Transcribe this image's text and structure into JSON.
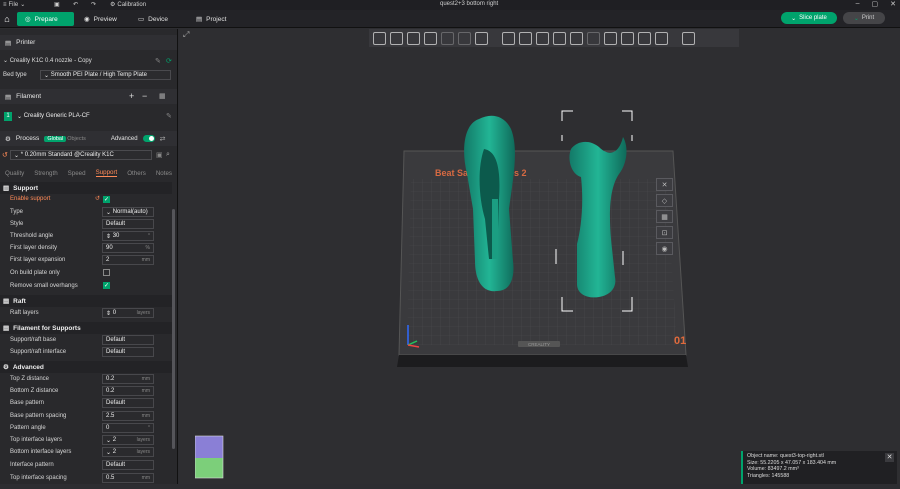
{
  "titlebar": {
    "file_label": "File",
    "calibration_label": "Calibration",
    "window_title": "quest2+3 bottom right",
    "minimize": "–",
    "maximize": "▢",
    "close": "✕"
  },
  "tabs": [
    {
      "label": "Prepare",
      "icon": "prepare-icon"
    },
    {
      "label": "Preview",
      "icon": "preview-icon"
    },
    {
      "label": "Device",
      "icon": "device-icon"
    },
    {
      "label": "Project",
      "icon": "project-icon"
    }
  ],
  "actions": {
    "slice_label": "Slice plate",
    "print_label": "Print"
  },
  "printer": {
    "section_label": "Printer",
    "name": "Creality K1C 0.4 nozzle - Copy",
    "bed_type_label": "Bed type",
    "bed_type_value": "Smooth PEI Plate / High Temp Plate"
  },
  "filament": {
    "section_label": "Filament",
    "add": "+",
    "remove": "−",
    "slot": "1",
    "name": "Creality Generic PLA-CF"
  },
  "process": {
    "section_label": "Process",
    "global_label": "Global",
    "objects_label": "Objects",
    "advanced_label": "Advanced",
    "preset": "* 0.20mm Standard @Creality K1C"
  },
  "process_tabs": [
    "Quality",
    "Strength",
    "Speed",
    "Support",
    "Others",
    "Notes"
  ],
  "support": {
    "group_label": "Support",
    "enable_support": "Enable support",
    "type_label": "Type",
    "type_value": "Normal(auto)",
    "style_label": "Style",
    "style_value": "Default",
    "threshold_label": "Threshold angle",
    "threshold_value": "30",
    "threshold_unit": "°",
    "first_layer_density_label": "First layer density",
    "first_layer_density_value": "90",
    "first_layer_density_unit": "%",
    "first_layer_expansion_label": "First layer expansion",
    "first_layer_expansion_value": "2",
    "first_layer_expansion_unit": "mm",
    "on_build_plate_label": "On build plate only",
    "remove_small_label": "Remove small overhangs"
  },
  "raft": {
    "group_label": "Raft",
    "layers_label": "Raft layers",
    "layers_value": "0",
    "layers_unit": "layers"
  },
  "filament_supports": {
    "group_label": "Filament for Supports",
    "base_label": "Support/raft base",
    "base_value": "Default",
    "interface_label": "Support/raft interface",
    "interface_value": "Default"
  },
  "advanced": {
    "group_label": "Advanced",
    "top_z_label": "Top Z distance",
    "top_z_value": "0.2",
    "top_z_unit": "mm",
    "bottom_z_label": "Bottom Z distance",
    "bottom_z_value": "0.2",
    "bottom_z_unit": "mm",
    "base_pattern_label": "Base pattern",
    "base_pattern_value": "Default",
    "base_spacing_label": "Base pattern spacing",
    "base_spacing_value": "2.5",
    "base_spacing_unit": "mm",
    "pattern_angle_label": "Pattern angle",
    "pattern_angle_value": "0",
    "pattern_angle_unit": "°",
    "top_interface_label": "Top interface layers",
    "top_interface_value": "2",
    "top_interface_unit": "layers",
    "bottom_interface_label": "Bottom interface layers",
    "bottom_interface_value": "2",
    "bottom_interface_unit": "layers",
    "interface_pattern_label": "Interface pattern",
    "interface_pattern_value": "Default",
    "top_interface_spacing_label": "Top interface spacing",
    "top_interface_spacing_value": "0.5",
    "top_interface_spacing_unit": "mm"
  },
  "viewport": {
    "plate_number": "01",
    "plate_text": "Beat Saber Paddles 2",
    "brand_text": "CREALITY"
  },
  "object_info": {
    "name_line": "Object name: quest3-top-right.stl",
    "size_line": "Size: 55.2205 x 47.057 x 183.404 mm",
    "volume_line": "Volume: 83497.2 mm³",
    "triangles_line": "Triangles: 145588",
    "close": "✕"
  },
  "colors": {
    "accent": "#00a36c",
    "support_tab": "#ff8a57",
    "model": "#1aa58a",
    "plate": "#3a3a3d"
  }
}
